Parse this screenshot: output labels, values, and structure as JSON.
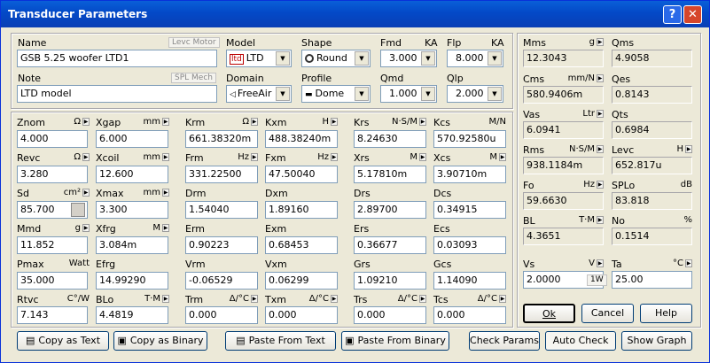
{
  "window": {
    "title": "Transducer Parameters",
    "help_glyph": "?",
    "close_glyph": "✕"
  },
  "top": {
    "name_label": "Name",
    "name_btn": "Levc Motor",
    "name_value": "GSB 5.25 woofer LTD1",
    "note_label": "Note",
    "note_btn": "SPL Mech",
    "note_value": "LTD model",
    "model_label": "Model",
    "model_value": "LTD",
    "domain_label": "Domain",
    "domain_value": "FreeAir",
    "shape_label": "Shape",
    "shape_value": "Round",
    "profile_label": "Profile",
    "profile_value": "Dome",
    "fmd_label": "Fmd",
    "fmd_unit": "KA",
    "fmd_value": "3.000",
    "flp_label": "Flp",
    "flp_unit": "KA",
    "flp_value": "8.000",
    "qmd_label": "Qmd",
    "qmd_value": "1.000",
    "qlp_label": "Qlp",
    "qlp_value": "2.000"
  },
  "params": {
    "znom": {
      "label": "Znom",
      "unit": "Ω",
      "value": "4.000"
    },
    "xgap": {
      "label": "Xgap",
      "unit": "mm",
      "value": "6.000"
    },
    "revc": {
      "label": "Revc",
      "unit": "Ω",
      "value": "3.280"
    },
    "xcoil": {
      "label": "Xcoil",
      "unit": "mm",
      "value": "12.600"
    },
    "sd": {
      "label": "Sd",
      "unit": "cm²",
      "value": "85.700"
    },
    "xmax": {
      "label": "Xmax",
      "unit": "mm",
      "value": "3.300"
    },
    "mmd": {
      "label": "Mmd",
      "unit": "g",
      "value": "11.852"
    },
    "xfrg": {
      "label": "Xfrg",
      "unit": "M",
      "value": "3.084m"
    },
    "pmax": {
      "label": "Pmax",
      "unit": "Watt",
      "value": "35.000"
    },
    "efrg": {
      "label": "Efrg",
      "value": "14.99290"
    },
    "rtvc": {
      "label": "Rtvc",
      "unit": "C°/W",
      "value": "7.143"
    },
    "blo": {
      "label": "BLo",
      "unit": "T·M",
      "value": "4.4819"
    },
    "krm": {
      "label": "Krm",
      "unit": "Ω",
      "value": "661.38320m"
    },
    "kxm": {
      "label": "Kxm",
      "unit": "H",
      "value": "488.38240m"
    },
    "frm": {
      "label": "Frm",
      "unit": "Hz",
      "value": "331.22500"
    },
    "fxm": {
      "label": "Fxm",
      "unit": "Hz",
      "value": "47.50040"
    },
    "drm": {
      "label": "Drm",
      "value": "1.54040"
    },
    "dxm": {
      "label": "Dxm",
      "value": "1.89160"
    },
    "erm": {
      "label": "Erm",
      "value": "0.90223"
    },
    "exm": {
      "label": "Exm",
      "value": "0.68453"
    },
    "vrm": {
      "label": "Vrm",
      "value": "-0.06529"
    },
    "vxm": {
      "label": "Vxm",
      "value": "0.06299"
    },
    "trm": {
      "label": "Trm",
      "unit": "Δ/°C",
      "value": "0.000"
    },
    "txm": {
      "label": "Txm",
      "unit": "Δ/°C",
      "value": "0.000"
    },
    "krs": {
      "label": "Krs",
      "unit": "N·S/M",
      "value": "8.24630"
    },
    "kcs": {
      "label": "Kcs",
      "unit": "M/N",
      "value": "570.92580u"
    },
    "xrs": {
      "label": "Xrs",
      "unit": "M",
      "value": "5.17810m"
    },
    "xcs": {
      "label": "Xcs",
      "unit": "M",
      "value": "3.90710m"
    },
    "drs": {
      "label": "Drs",
      "value": "2.89700"
    },
    "dcs": {
      "label": "Dcs",
      "value": "0.34915"
    },
    "ers": {
      "label": "Ers",
      "value": "0.36677"
    },
    "ecs": {
      "label": "Ecs",
      "value": "0.03093"
    },
    "grs": {
      "label": "Grs",
      "value": "1.09210"
    },
    "gcs": {
      "label": "Gcs",
      "value": "1.14090"
    },
    "trs": {
      "label": "Trs",
      "unit": "Δ/°C",
      "value": "0.000"
    },
    "tcs": {
      "label": "Tcs",
      "unit": "Δ/°C",
      "value": "0.000"
    }
  },
  "results": {
    "mms": {
      "label": "Mms",
      "unit": "g",
      "value": "12.3043"
    },
    "qms": {
      "label": "Qms",
      "value": "4.9058"
    },
    "cms": {
      "label": "Cms",
      "unit": "mm/N",
      "value": "580.9406m"
    },
    "qes": {
      "label": "Qes",
      "value": "0.8143"
    },
    "vas": {
      "label": "Vas",
      "unit": "Ltr",
      "value": "6.0941"
    },
    "qts": {
      "label": "Qts",
      "value": "0.6984"
    },
    "rms": {
      "label": "Rms",
      "unit": "N·S/M",
      "value": "938.1184m"
    },
    "levc": {
      "label": "Levc",
      "unit": "H",
      "value": "652.817u"
    },
    "fo": {
      "label": "Fo",
      "unit": "Hz",
      "value": "59.6630"
    },
    "splo": {
      "label": "SPLo",
      "unit": "dB",
      "value": "83.818"
    },
    "bl": {
      "label": "BL",
      "unit": "T·M",
      "value": "4.3651"
    },
    "no": {
      "label": "No",
      "unit": "%",
      "value": "0.1514"
    },
    "vs": {
      "label": "Vs",
      "unit": "V",
      "value": "2.0000",
      "btn": "1W"
    },
    "ta": {
      "label": "Ta",
      "unit": "°C",
      "value": "25.00"
    }
  },
  "buttons": {
    "ok": "Ok",
    "cancel": "Cancel",
    "help": "Help",
    "copy_text": "Copy as Text",
    "copy_binary": "Copy as Binary",
    "paste_text": "Paste From Text",
    "paste_binary": "Paste From Binary",
    "check_params": "Check Params",
    "auto_check": "Auto Check",
    "show_graph": "Show Graph"
  }
}
